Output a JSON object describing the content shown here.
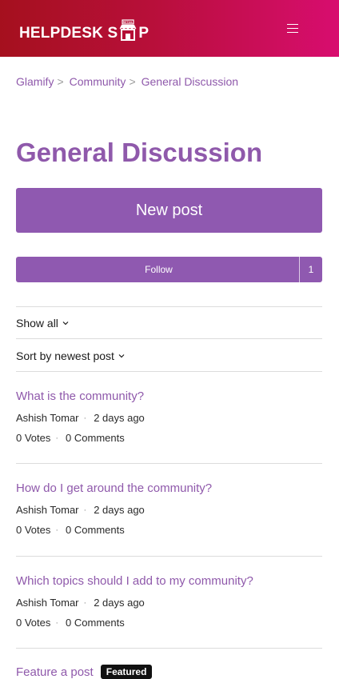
{
  "header": {
    "logo_left": "HELPDESK S",
    "logo_right": "P",
    "logo_sign": "RETAIL"
  },
  "breadcrumb": [
    "Glamify",
    "Community",
    "General Discussion"
  ],
  "page_title": "General Discussion",
  "new_post_label": "New post",
  "follow": {
    "label": "Follow",
    "count": "1"
  },
  "filters": {
    "show": "Show all",
    "sort": "Sort by newest post"
  },
  "posts": [
    {
      "title": "What is the community?",
      "author": "Ashish Tomar",
      "time": "2 days ago",
      "votes": "0 Votes",
      "comments": "0 Comments"
    },
    {
      "title": "How do I get around the community?",
      "author": "Ashish Tomar",
      "time": "2 days ago",
      "votes": "0 Votes",
      "comments": "0 Comments"
    },
    {
      "title": "Which topics should I add to my community?",
      "author": "Ashish Tomar",
      "time": "2 days ago",
      "votes": "0 Votes",
      "comments": "0 Comments"
    },
    {
      "title": "Feature a post",
      "badge": "Featured"
    }
  ],
  "colors": {
    "accent": "#8f59b0",
    "header_start": "#a5101e",
    "header_end": "#d80d6f"
  }
}
